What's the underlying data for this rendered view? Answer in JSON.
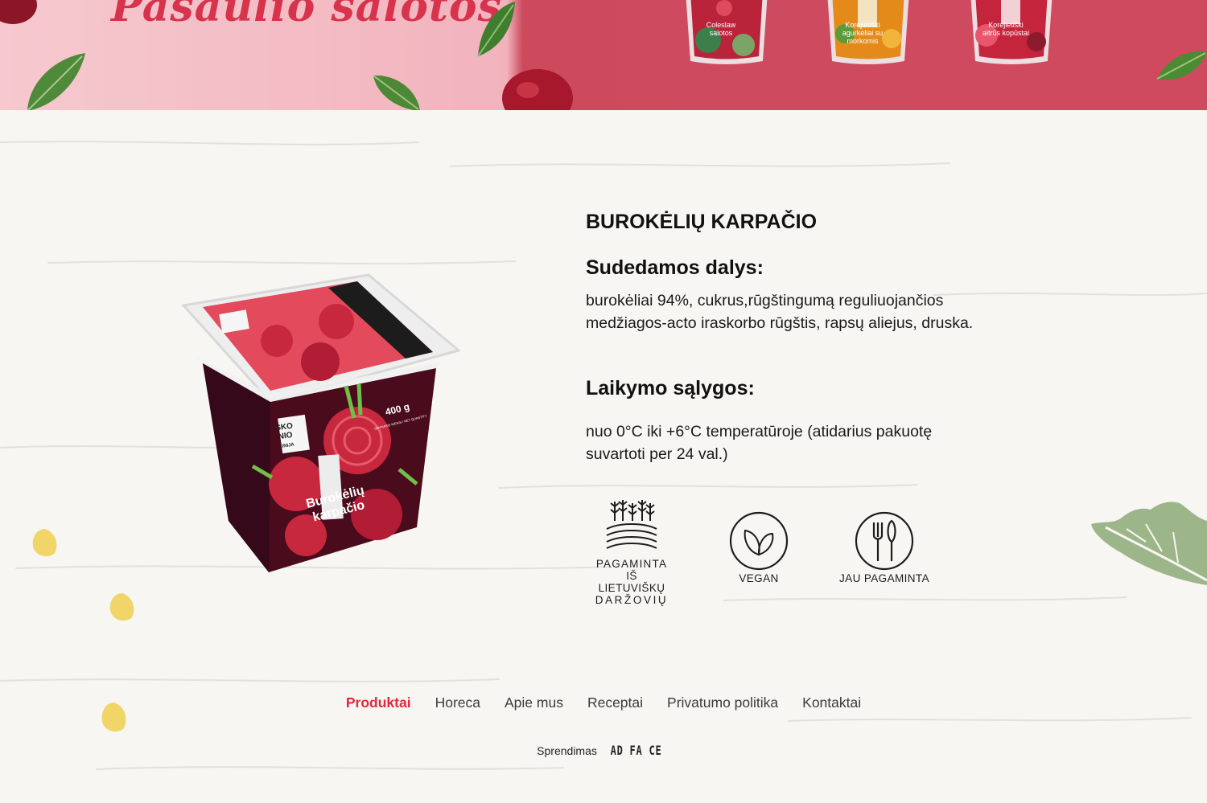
{
  "hero": {
    "title": "Pasaulio salotos",
    "packs": [
      {
        "label": "Coleslaw salotos",
        "color": "#b9243a"
      },
      {
        "label": "Korėjietiški agurkėliai su morkomis",
        "color": "#e38a1a"
      },
      {
        "label": "Korėjietiški aitrūs kopūstai",
        "color": "#c5243d"
      }
    ]
  },
  "product": {
    "title": "BUROKĖLIŲ KARPAČIO",
    "image": {
      "brand_lines": [
        "SKO",
        "NIO",
        "LINIJA"
      ],
      "name_lines": [
        "Burokėlių",
        "karpačio"
      ],
      "weight": "400 g",
      "net_quantity": "GRYNASIS KIEKIS / NET QUANTITY"
    },
    "ingredients_heading": "Sudedamos dalys:",
    "ingredients_text": "burokėliai 94%, cukrus,rūgštingumą reguliuojančios medžiagos-acto iraskorbo rūgštis, rapsų aliejus, druska.",
    "storage_heading": "Laikymo sąlygos:",
    "storage_text": "nuo 0°C iki +6°C temperatūroje (atidarius pakuotę suvartoti per 24 val.)"
  },
  "badges": [
    {
      "icon": "field-crops-icon",
      "lines": [
        "PAGAMINTA",
        "IŠ LIETUVIŠKŲ",
        "DARŽOVIŲ"
      ]
    },
    {
      "icon": "leaf-icon",
      "lines": [
        "VEGAN"
      ]
    },
    {
      "icon": "cutlery-icon",
      "lines": [
        "JAU PAGAMINTA"
      ]
    }
  ],
  "footer": {
    "nav": [
      {
        "label": "Produktai",
        "active": true
      },
      {
        "label": "Horeca",
        "active": false
      },
      {
        "label": "Apie mus",
        "active": false
      },
      {
        "label": "Receptai",
        "active": false
      },
      {
        "label": "Privatumo politika",
        "active": false
      },
      {
        "label": "Kontaktai",
        "active": false
      }
    ],
    "credit_prefix": "Sprendimas",
    "credit_brand": "AD FA CE"
  },
  "colors": {
    "accent": "#e4283f",
    "beet": "#5a0f22",
    "label_red": "#e34a5c",
    "background": "#f7f6f3"
  }
}
